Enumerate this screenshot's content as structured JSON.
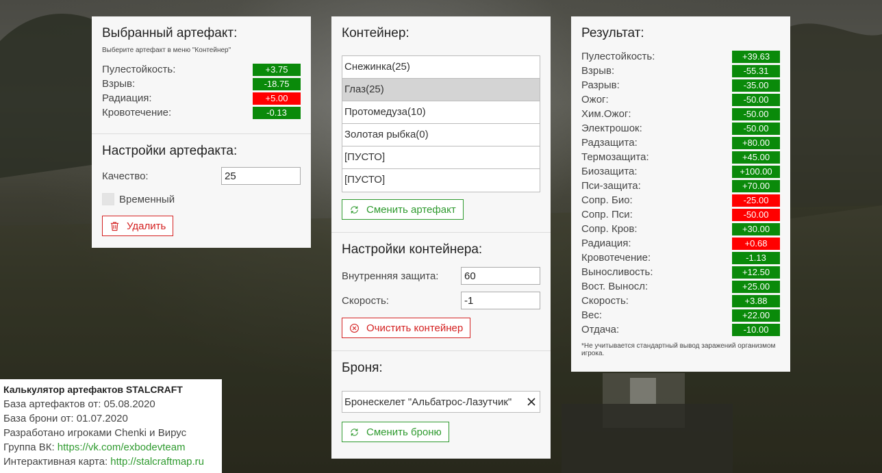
{
  "selected_artifact": {
    "title": "Выбранный артефакт:",
    "hint": "Выберите артефакт в меню \"Контейнер\"",
    "stats": [
      {
        "label": "Пулестойкость:",
        "value": "+3.75",
        "color": "green"
      },
      {
        "label": "Взрыв:",
        "value": "-18.75",
        "color": "green"
      },
      {
        "label": "Радиация:",
        "value": "+5.00",
        "color": "red"
      },
      {
        "label": "Кровотечение:",
        "value": "-0.13",
        "color": "green"
      }
    ]
  },
  "artifact_settings": {
    "title": "Настройки артефакта:",
    "quality_label": "Качество:",
    "quality_value": "25",
    "temporary_label": "Временный",
    "delete_label": "Удалить"
  },
  "container": {
    "title": "Контейнер:",
    "slots": [
      "Снежинка(25)",
      "Глаз(25)",
      "Протомедуза(10)",
      "Золотая рыбка(0)",
      "[ПУСТО]",
      "[ПУСТО]"
    ],
    "selected_slot": "Глаз(25)",
    "change_artifact_label": "Сменить артефакт"
  },
  "container_settings": {
    "title": "Настройки контейнера:",
    "inner_protection_label": "Внутренняя защита:",
    "inner_protection_value": "60",
    "speed_label": "Скорость:",
    "speed_value": "-1",
    "clear_label": "Очистить контейнер"
  },
  "armor": {
    "title": "Броня:",
    "selected": "Бронескелет \"Альбатрос-Лазутчик\"",
    "change_label": "Сменить броню"
  },
  "result": {
    "title": "Результат:",
    "stats": [
      {
        "label": "Пулестойкость:",
        "value": "+39.63",
        "color": "green"
      },
      {
        "label": "Взрыв:",
        "value": "-55.31",
        "color": "green"
      },
      {
        "label": "Разрыв:",
        "value": "-35.00",
        "color": "green"
      },
      {
        "label": "Ожог:",
        "value": "-50.00",
        "color": "green"
      },
      {
        "label": "Хим.Ожог:",
        "value": "-50.00",
        "color": "green"
      },
      {
        "label": "Электрошок:",
        "value": "-50.00",
        "color": "green"
      },
      {
        "label": "Радзащита:",
        "value": "+80.00",
        "color": "green"
      },
      {
        "label": "Термозащита:",
        "value": "+45.00",
        "color": "green"
      },
      {
        "label": "Биозащита:",
        "value": "+100.00",
        "color": "green"
      },
      {
        "label": "Пси-защита:",
        "value": "+70.00",
        "color": "green"
      },
      {
        "label": "Сопр. Био:",
        "value": "-25.00",
        "color": "red"
      },
      {
        "label": "Сопр. Пси:",
        "value": "-50.00",
        "color": "red"
      },
      {
        "label": "Сопр. Кров:",
        "value": "+30.00",
        "color": "green"
      },
      {
        "label": "Радиация:",
        "value": "+0.68",
        "color": "red"
      },
      {
        "label": "Кровотечение:",
        "value": "-1.13",
        "color": "green"
      },
      {
        "label": "Выносливость:",
        "value": "+12.50",
        "color": "green"
      },
      {
        "label": "Вост. Выносл:",
        "value": "+25.00",
        "color": "green"
      },
      {
        "label": "Скорость:",
        "value": "+3.88",
        "color": "green"
      },
      {
        "label": "Вес:",
        "value": "+22.00",
        "color": "green"
      },
      {
        "label": "Отдача:",
        "value": "-10.00",
        "color": "green"
      }
    ],
    "note": "*Не учитывается стандартный вывод заражений организмом игрока."
  },
  "info": {
    "title": "Калькулятор артефактов STALCRAFT",
    "artifacts_db": "База артефактов от: 05.08.2020",
    "armor_db": "База брони от: 01.07.2020",
    "developers": "Разработано игроками Chenki и Вирус",
    "vk_label": "Группа ВК:",
    "vk_link": "https://vk.com/exbodevteam",
    "map_label": "Интерактивная карта:",
    "map_link": "http://stalcraftmap.ru"
  },
  "colors": {
    "green": "#0a8a0a",
    "red": "#ff0000",
    "button_green": "#2e9a2e",
    "button_red": "#d42020"
  }
}
